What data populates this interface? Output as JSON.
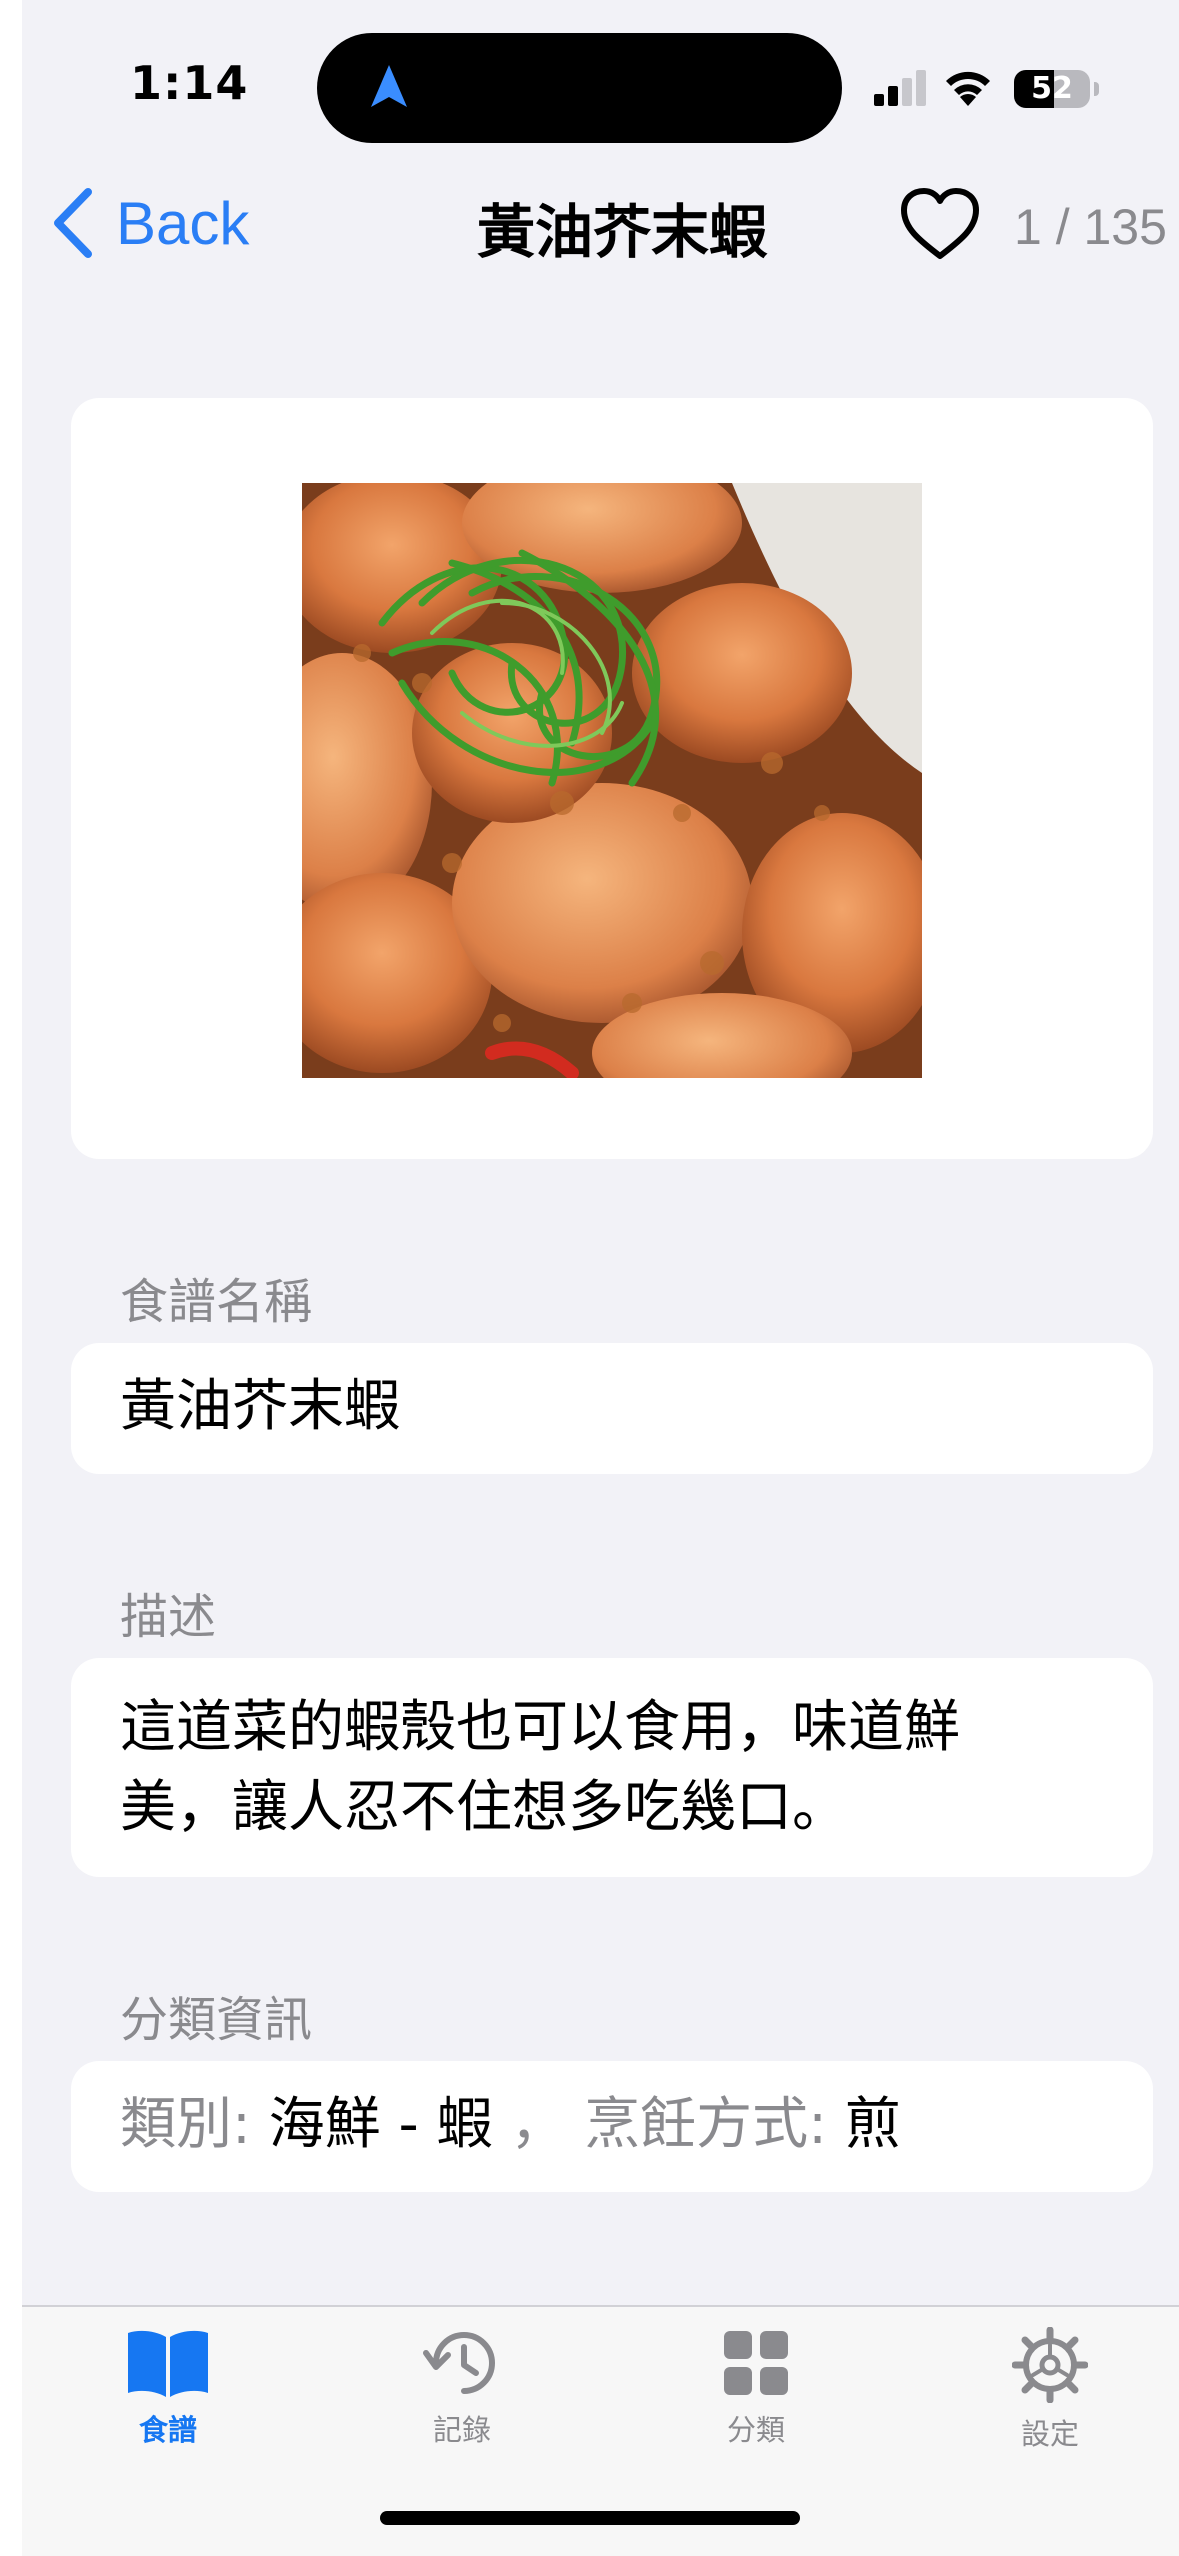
{
  "status_bar": {
    "time": "1:14",
    "battery_percent": 52,
    "battery_text": "52",
    "icons": [
      "location-arrow-icon",
      "cellular-signal-icon",
      "wifi-icon",
      "battery-icon"
    ]
  },
  "nav": {
    "back_label": "Back",
    "title": "黃油芥末蝦",
    "counter": "1 / 135",
    "favorite_icon": "heart-outline-icon"
  },
  "recipe": {
    "image_alt": "shrimp-dish-photo",
    "name_label": "食譜名稱",
    "name_value": "黃油芥末蝦",
    "description_label": "描述",
    "description_value": "這道菜的蝦殼也可以食用，味道鮮美，讓人忍不住想多吃幾口。",
    "category_section_label": "分類資訊",
    "category_prefix": "類別: ",
    "category_value": "海鮮 - 蝦",
    "separator": " ， ",
    "method_prefix": "烹飪方式: ",
    "method_value": "煎"
  },
  "tabbar": {
    "tabs": [
      {
        "label": "食譜",
        "icon": "book-icon",
        "active": true
      },
      {
        "label": "記錄",
        "icon": "history-icon",
        "active": false
      },
      {
        "label": "分類",
        "icon": "grid-icon",
        "active": false
      },
      {
        "label": "設定",
        "icon": "gear-icon",
        "active": false
      }
    ]
  },
  "colors": {
    "accent": "#1677f2",
    "background": "#f2f2f7",
    "card": "#ffffff",
    "secondary_text": "#8a8a8e"
  }
}
